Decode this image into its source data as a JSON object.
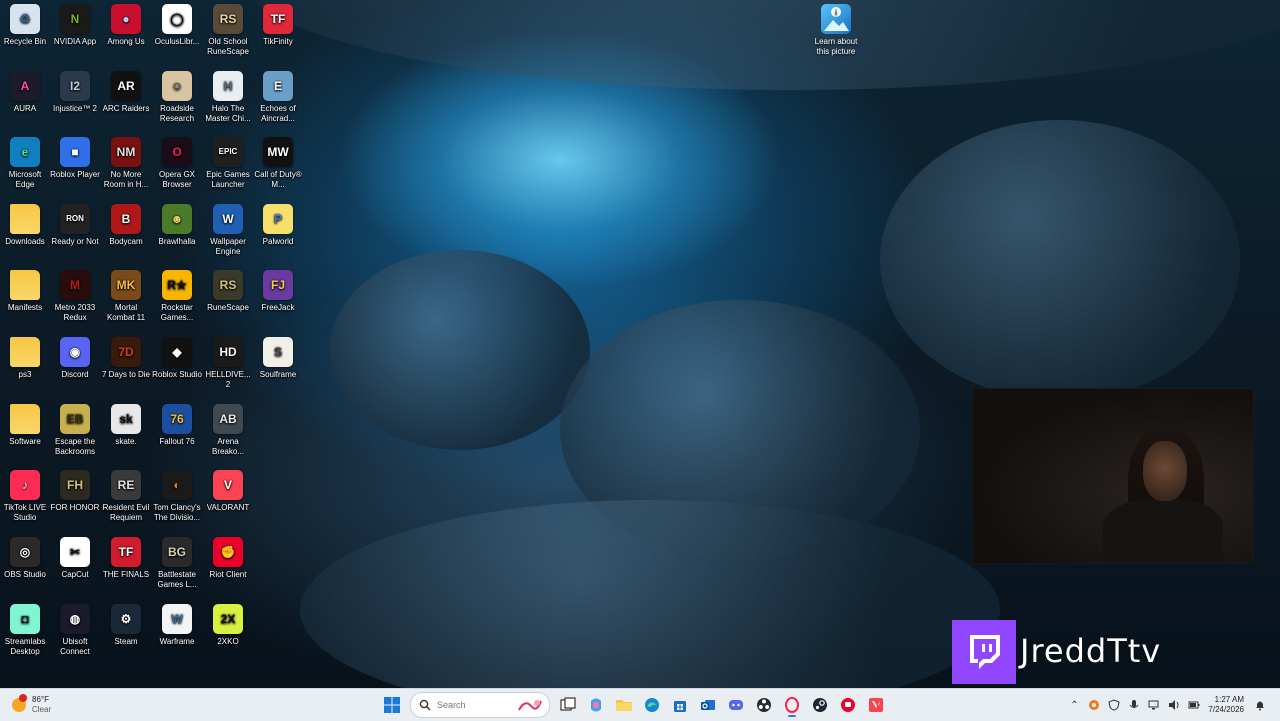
{
  "desktop": {
    "icons": [
      {
        "label": "Recycle Bin",
        "icon": "recycle-bin-icon",
        "bg": "#d7e3ee",
        "fg": "#3a5f85",
        "glyph": "♻"
      },
      {
        "label": "NVIDIA App",
        "icon": "nvidia-icon",
        "bg": "#1a1a1a",
        "fg": "#76b900",
        "glyph": "N"
      },
      {
        "label": "Among Us",
        "icon": "among-us-icon",
        "bg": "#c8102e",
        "fg": "#9fd4ff",
        "glyph": "●"
      },
      {
        "label": "OculusLibr...",
        "icon": "oculus-icon",
        "bg": "#ffffff",
        "fg": "#111111",
        "glyph": "◯"
      },
      {
        "label": "Old School RuneScape",
        "icon": "osrs-icon",
        "bg": "#5a4a3a",
        "fg": "#e8d6a0",
        "glyph": "RS"
      },
      {
        "label": "TikFinity",
        "icon": "tikfinity-icon",
        "bg": "#e0283a",
        "fg": "#ffffff",
        "glyph": "TF"
      },
      {
        "label": "AURA",
        "icon": "aura-icon",
        "bg": "#1b1b2a",
        "fg": "#ff4fb0",
        "glyph": "A"
      },
      {
        "label": "Injustice™ 2",
        "icon": "injustice-icon",
        "bg": "#2b3a4a",
        "fg": "#c0d0e0",
        "glyph": "I2"
      },
      {
        "label": "ARC Raiders",
        "icon": "arc-raiders-icon",
        "bg": "#111111",
        "fg": "#ffffff",
        "glyph": "AR"
      },
      {
        "label": "Roadside Research",
        "icon": "roadside-research-icon",
        "bg": "#d8c4a0",
        "fg": "#333333",
        "glyph": "☺"
      },
      {
        "label": "Halo The Master Chi...",
        "icon": "halo-icon",
        "bg": "#e8eef2",
        "fg": "#5a6a7a",
        "glyph": "H"
      },
      {
        "label": "Echoes of Aincrad...",
        "icon": "echoes-aincrad-icon",
        "bg": "#6aa0c8",
        "fg": "#ffffff",
        "glyph": "E"
      },
      {
        "label": "Microsoft Edge",
        "icon": "edge-icon",
        "bg": "#0f7fc0",
        "fg": "#52e08a",
        "glyph": "e"
      },
      {
        "label": "Roblox Player",
        "icon": "roblox-player-icon",
        "bg": "#2f6fe8",
        "fg": "#ffffff",
        "glyph": "■"
      },
      {
        "label": "No More Room in H...",
        "icon": "no-more-room-icon",
        "bg": "#7a1010",
        "fg": "#e0e0e0",
        "glyph": "NM"
      },
      {
        "label": "Opera GX Browser",
        "icon": "opera-gx-icon",
        "bg": "#1a0d1a",
        "fg": "#fa1e4e",
        "glyph": "O"
      },
      {
        "label": "Epic Games Launcher",
        "icon": "epic-games-icon",
        "bg": "#1f1f1f",
        "fg": "#ffffff",
        "glyph": "EPIC"
      },
      {
        "label": "Call of Duty® M...",
        "icon": "call-of-duty-icon",
        "bg": "#111111",
        "fg": "#ffffff",
        "glyph": "MW"
      },
      {
        "label": "Downloads",
        "icon": "folder-icon",
        "bg": "#f6c744",
        "fg": "#b88a10",
        "glyph": ""
      },
      {
        "label": "Ready or Not",
        "icon": "ready-or-not-icon",
        "bg": "#222222",
        "fg": "#ffffff",
        "glyph": "RON"
      },
      {
        "label": "Bodycam",
        "icon": "bodycam-icon",
        "bg": "#b01818",
        "fg": "#ffffff",
        "glyph": "B"
      },
      {
        "label": "Brawlhalla",
        "icon": "brawlhalla-icon",
        "bg": "#4a7a2a",
        "fg": "#f2d060",
        "glyph": "☻"
      },
      {
        "label": "Wallpaper Engine",
        "icon": "wallpaper-engine-icon",
        "bg": "#1f5fb4",
        "fg": "#ffffff",
        "glyph": "W"
      },
      {
        "label": "Palworld",
        "icon": "palworld-icon",
        "bg": "#f4e06a",
        "fg": "#3a7ad0",
        "glyph": "P"
      },
      {
        "label": "Manifests",
        "icon": "folder-icon",
        "bg": "#f6c744",
        "fg": "#b88a10",
        "glyph": ""
      },
      {
        "label": "Metro 2033 Redux",
        "icon": "metro-icon",
        "bg": "#2a0c0c",
        "fg": "#c01c1c",
        "glyph": "M"
      },
      {
        "label": "Mortal Kombat 11",
        "icon": "mortal-kombat-icon",
        "bg": "#7a4a1a",
        "fg": "#f2c040",
        "glyph": "MK"
      },
      {
        "label": "Rockstar Games...",
        "icon": "rockstar-icon",
        "bg": "#f7b500",
        "fg": "#111111",
        "glyph": "R★"
      },
      {
        "label": "RuneScape",
        "icon": "runescape-icon",
        "bg": "#3a3a2a",
        "fg": "#d8c080",
        "glyph": "RS"
      },
      {
        "label": "FreeJack",
        "icon": "freejack-icon",
        "bg": "#6a3aa0",
        "fg": "#f2d040",
        "glyph": "FJ"
      },
      {
        "label": "ps3",
        "icon": "folder-icon",
        "bg": "#f6c744",
        "fg": "#b88a10",
        "glyph": ""
      },
      {
        "label": "Discord",
        "icon": "discord-icon",
        "bg": "#5865f2",
        "fg": "#ffffff",
        "glyph": "◉"
      },
      {
        "label": "7 Days to Die",
        "icon": "seven-days-icon",
        "bg": "#3a1a0a",
        "fg": "#d04020",
        "glyph": "7D"
      },
      {
        "label": "Roblox Studio",
        "icon": "roblox-studio-icon",
        "bg": "#111111",
        "fg": "#ffffff",
        "glyph": "◆"
      },
      {
        "label": "HELLDIVE... 2",
        "icon": "helldivers-icon",
        "bg": "#1a1a1a",
        "fg": "#f2f2f2",
        "glyph": "HD"
      },
      {
        "label": "Soulframe",
        "icon": "soulframe-icon",
        "bg": "#f2efe8",
        "fg": "#444444",
        "glyph": "S"
      },
      {
        "label": "Software",
        "icon": "folder-icon",
        "bg": "#f6c744",
        "fg": "#b88a10",
        "glyph": ""
      },
      {
        "label": "Escape the Backrooms",
        "icon": "escape-backrooms-icon",
        "bg": "#c8b050",
        "fg": "#3a3010",
        "glyph": "EB"
      },
      {
        "label": "skate.",
        "icon": "skate-icon",
        "bg": "#e8e8e8",
        "fg": "#111111",
        "glyph": "sk"
      },
      {
        "label": "Fallout 76",
        "icon": "fallout-icon",
        "bg": "#1c4fa0",
        "fg": "#f2c030",
        "glyph": "76"
      },
      {
        "label": "Arena Breako...",
        "icon": "arena-breakout-icon",
        "bg": "#404850",
        "fg": "#e8e8e8",
        "glyph": "AB"
      },
      {
        "label": "",
        "icon": "",
        "bg": "",
        "fg": "",
        "glyph": ""
      },
      {
        "label": "TikTok LIVE Studio",
        "icon": "tiktok-live-icon",
        "bg": "#fe2c55",
        "fg": "#ffffff",
        "glyph": "♪"
      },
      {
        "label": "FOR HONOR",
        "icon": "for-honor-icon",
        "bg": "#2a2a20",
        "fg": "#d8c070",
        "glyph": "FH"
      },
      {
        "label": "Resident Evil Requiem",
        "icon": "resident-evil-icon",
        "bg": "#3a3a3a",
        "fg": "#e0e0e0",
        "glyph": "RE"
      },
      {
        "label": "Tom Clancy's The Divisio...",
        "icon": "division-icon",
        "bg": "#1a1a1a",
        "fg": "#f27a20",
        "glyph": "◐"
      },
      {
        "label": "VALORANT",
        "icon": "valorant-icon",
        "bg": "#fa4454",
        "fg": "#ffffff",
        "glyph": "V"
      },
      {
        "label": "",
        "icon": "",
        "bg": "",
        "fg": "",
        "glyph": ""
      },
      {
        "label": "OBS Studio",
        "icon": "obs-icon",
        "bg": "#2a2a2a",
        "fg": "#ffffff",
        "glyph": "◎"
      },
      {
        "label": "CapCut",
        "icon": "capcut-icon",
        "bg": "#ffffff",
        "fg": "#111111",
        "glyph": "✂"
      },
      {
        "label": "THE FINALS",
        "icon": "the-finals-icon",
        "bg": "#d01c2c",
        "fg": "#ffffff",
        "glyph": "TF"
      },
      {
        "label": "Battlestate Games L...",
        "icon": "battlestate-icon",
        "bg": "#2a2a2a",
        "fg": "#d8d0b8",
        "glyph": "BG"
      },
      {
        "label": "Riot Client",
        "icon": "riot-client-icon",
        "bg": "#eb0029",
        "fg": "#ffffff",
        "glyph": "✊"
      },
      {
        "label": "",
        "icon": "",
        "bg": "",
        "fg": "",
        "glyph": ""
      },
      {
        "label": "Streamlabs Desktop",
        "icon": "streamlabs-icon",
        "bg": "#80f5d2",
        "fg": "#09161d",
        "glyph": "◘"
      },
      {
        "label": "Ubisoft Connect",
        "icon": "ubisoft-icon",
        "bg": "#1a1a2a",
        "fg": "#ffffff",
        "glyph": "◍"
      },
      {
        "label": "Steam",
        "icon": "steam-icon",
        "bg": "#1b2838",
        "fg": "#ffffff",
        "glyph": "⚙"
      },
      {
        "label": "Warframe",
        "icon": "warframe-icon",
        "bg": "#f2f4f6",
        "fg": "#3a6a9a",
        "glyph": "W"
      },
      {
        "label": "2XKO",
        "icon": "2xko-icon",
        "bg": "#d8f040",
        "fg": "#111111",
        "glyph": "2X"
      }
    ],
    "learn_about": {
      "label": "Learn about this picture",
      "icon": "learn-about-picture-icon"
    }
  },
  "overlay": {
    "twitch_name": "JreddTtv",
    "twitch_color": "#9146ff"
  },
  "taskbar": {
    "weather": {
      "temp": "86°F",
      "condition": "Clear"
    },
    "search_placeholder": "Search",
    "apps": [
      {
        "name": "start-button",
        "icon": "windows-logo-icon",
        "active": false
      },
      {
        "name": "search",
        "icon": "search-icon",
        "active": false
      },
      {
        "name": "task-view",
        "icon": "task-view-icon",
        "active": false
      },
      {
        "name": "copilot",
        "icon": "copilot-icon",
        "active": false
      },
      {
        "name": "file-explorer",
        "icon": "folder-icon",
        "active": false
      },
      {
        "name": "edge",
        "icon": "edge-icon",
        "active": false
      },
      {
        "name": "store",
        "icon": "store-icon",
        "active": false
      },
      {
        "name": "outlook",
        "icon": "outlook-icon",
        "active": false
      },
      {
        "name": "discord",
        "icon": "discord-icon",
        "active": false
      },
      {
        "name": "obs",
        "icon": "obs-icon",
        "active": false
      },
      {
        "name": "opera-gx",
        "icon": "opera-gx-icon",
        "active": true
      },
      {
        "name": "steam",
        "icon": "steam-icon",
        "active": false
      },
      {
        "name": "riot-client",
        "icon": "riot-client-icon",
        "active": false
      },
      {
        "name": "valorant",
        "icon": "valorant-icon",
        "active": false
      }
    ],
    "clock": {
      "time": "1:27 AM",
      "date": "7/24/2026"
    }
  }
}
